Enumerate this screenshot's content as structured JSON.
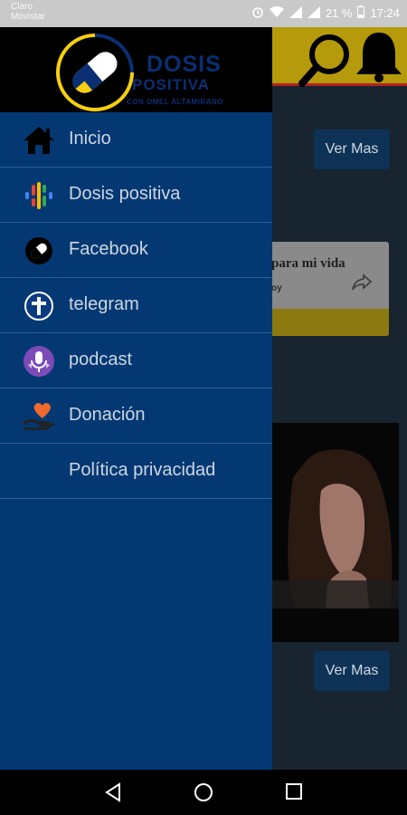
{
  "status_bar": {
    "carrier_line1": "Claro",
    "carrier_line2": "Movistar",
    "battery": "21 %",
    "time": "17:24"
  },
  "background": {
    "ver_mas_1": "Ver Mas",
    "ver_mas_2": "Ver Mas",
    "card_title": "para mi vida",
    "card_subtitle": "oy"
  },
  "drawer": {
    "logo": {
      "line1": "DOSIS",
      "line2": "POSITIVA",
      "line3": "CON OMEL ALTAMIRANO"
    },
    "items": [
      {
        "label": "Inicio",
        "icon": "home-icon"
      },
      {
        "label": "Dosis positiva",
        "icon": "podcast-bars-icon"
      },
      {
        "label": "Facebook",
        "icon": "facebook-pill-icon"
      },
      {
        "label": "telegram",
        "icon": "cross-icon"
      },
      {
        "label": "podcast",
        "icon": "microphone-icon"
      },
      {
        "label": "Donación",
        "icon": "heart-hand-icon"
      },
      {
        "label": "Política privacidad",
        "icon": ""
      }
    ]
  },
  "colors": {
    "drawer_bg": "#043873",
    "header_bg": "#000000",
    "accent_yellow": "#f5cf0f",
    "button_bg": "#0d3256"
  }
}
